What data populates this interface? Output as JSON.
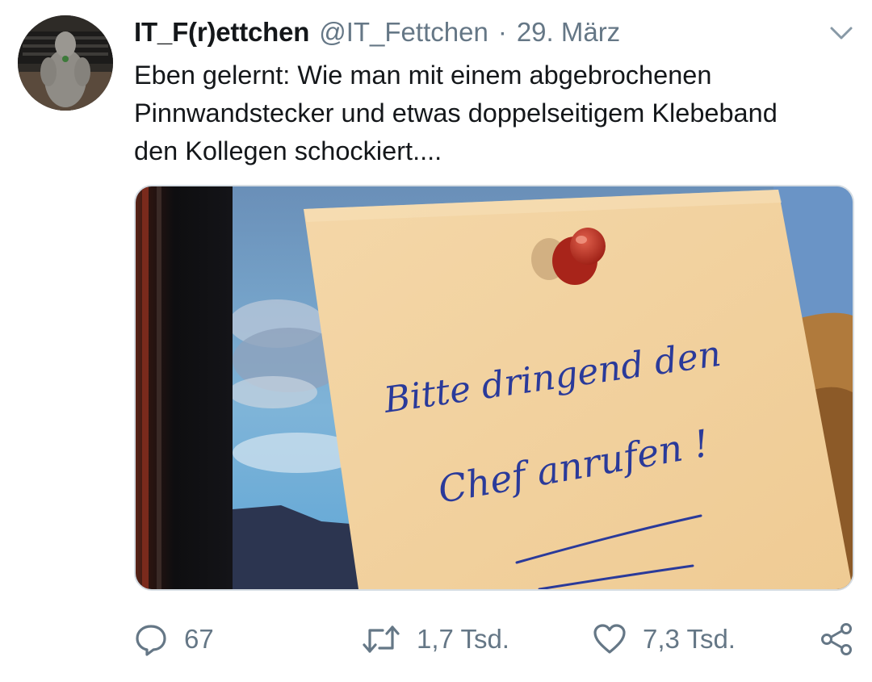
{
  "tweet": {
    "display_name": "IT_F(r)ettchen",
    "handle": "@IT_Fettchen",
    "separator": "·",
    "date": "29. März",
    "text_lines": [
      "Eben gelernt: Wie man mit einem abgebrochenen",
      "Pinnwandstecker und etwas doppelseitigem Klebeband",
      "den Kollegen schockiert...."
    ],
    "media": {
      "handwriting_line1": "Bitte dringend den",
      "handwriting_line2": "Chef anrufen !"
    },
    "actions": {
      "reply": {
        "icon": "reply-icon",
        "count": "67"
      },
      "retweet": {
        "icon": "retweet-icon",
        "count": "1,7 Tsd."
      },
      "like": {
        "icon": "heart-icon",
        "count": "7,3 Tsd."
      },
      "share": {
        "icon": "share-icon"
      }
    }
  },
  "colors": {
    "text": "#14171a",
    "secondary": "#657786",
    "note": "#f1d09f",
    "ink": "#2a3a9a",
    "pin": "#b6281e"
  }
}
